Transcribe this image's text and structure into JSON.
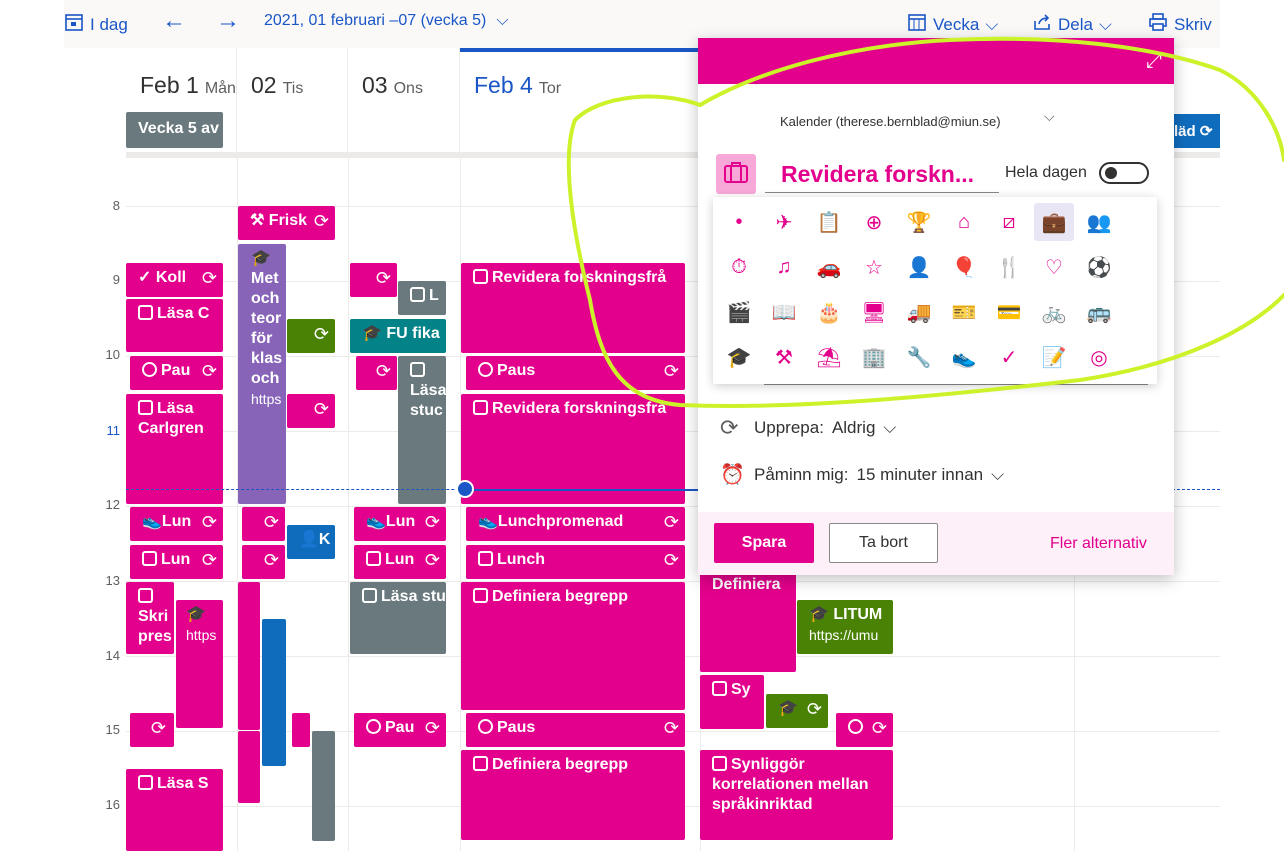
{
  "toolbar": {
    "today_label": "I dag",
    "date_range": "2021, 01 februari –07 (vecka 5)",
    "view_label": "Vecka",
    "share_label": "Dela",
    "print_label": "Skriv"
  },
  "days": [
    {
      "num": "Feb 1",
      "weekday": "Mån"
    },
    {
      "num": "02",
      "weekday": "Tis"
    },
    {
      "num": "03",
      "weekday": "Ons"
    },
    {
      "num": "Feb 4",
      "weekday": "Tor"
    }
  ],
  "week_badge": "Vecka 5 av",
  "hours": [
    "8",
    "9",
    "10",
    "11",
    "12",
    "13",
    "14",
    "15",
    "16"
  ],
  "events": {
    "mon_koll": "Koll",
    "mon_lasa_c": "Läsa C",
    "mon_paus": "Pau",
    "mon_lasa_carlgren_1": "Läsa",
    "mon_lasa_carlgren_2": "Carlgren",
    "mon_lunchpromenad": "Lun",
    "mon_lunch": "Lun",
    "mon_skri": "Skri pres",
    "mon_https": "https",
    "mon_lasa_s": "Läsa S",
    "tue_frisk": "Frisk",
    "tue_metod": "Met och teor för klas och",
    "tue_metod_link": "https",
    "tue_k": "K",
    "wed_fu_fika": "FU fika",
    "wed_l": "L",
    "wed_lasa_stud": "Läsa stuc",
    "wed_lunchpromenad": "Lun",
    "wed_lunch": "Lun",
    "wed_lasa_studenttext": "Läsa studenttex",
    "wed_paus": "Pau",
    "thu_revidera_1": "Revidera forskningsfrå",
    "thu_paus_1": "Paus",
    "thu_revidera_2": "Revidera forskningsfrå",
    "thu_lunchpromenad": "Lunchpromenad",
    "thu_lunch": "Lunch",
    "thu_definiera_1": "Definiera begrepp",
    "thu_paus_2": "Paus",
    "thu_definiera_2": "Definiera begrepp",
    "fri_definiera": "Definiera",
    "fri_litum": "LITUM",
    "fri_litum_link": "https://umu",
    "fri_sy": "Sy",
    "fri_synliggor": "Synliggör korrelationen mellan språkinriktad",
    "fri_lad": "läd"
  },
  "popup": {
    "calendar": "Kalender (therese.bernblad@miun.se)",
    "title_value": "Revidera forskn...",
    "allday_label": "Hela dagen",
    "repeat_label": "Upprepa:",
    "repeat_value": "Aldrig",
    "remind_label": "Påminn mig:",
    "remind_value": "15 minuter innan",
    "save": "Spara",
    "delete": "Ta bort",
    "more": "Fler alternativ"
  },
  "picker_icons": [
    [
      "dot",
      "airplane",
      "notepad",
      "first-aid",
      "trophy",
      "home",
      "bandage",
      "briefcase",
      "people"
    ],
    [
      "timer",
      "music",
      "car",
      "star",
      "person",
      "balloon",
      "fork-knife",
      "heart",
      "soccer"
    ],
    [
      "clapper",
      "book",
      "cake",
      "monitor",
      "truck",
      "ticket",
      "credit-card",
      "bicycle",
      "bus"
    ],
    [
      "graduation",
      "dumbbell",
      "beach",
      "building",
      "wrench",
      "shoe",
      "checkmark",
      "survey",
      "target"
    ]
  ],
  "colors": {
    "accent": "#e3008c",
    "today": "#1a56c6",
    "annotation": "#ccf22a"
  }
}
